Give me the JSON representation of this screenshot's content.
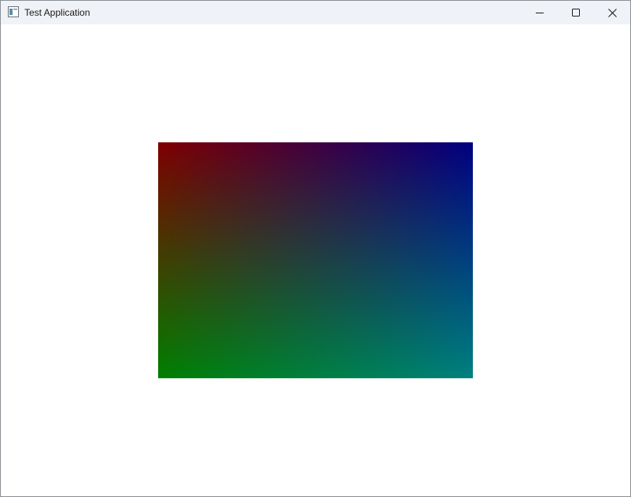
{
  "window": {
    "title": "Test Application",
    "app_icon": "window-app-icon",
    "caption_buttons": [
      {
        "name": "minimize",
        "icon": "minimize-icon"
      },
      {
        "name": "maximize",
        "icon": "maximize-icon"
      },
      {
        "name": "close",
        "icon": "close-icon"
      }
    ]
  },
  "canvas": {
    "corner_colors": {
      "top_left": "#800000",
      "top_right": "#000080",
      "bottom_left": "#008000",
      "bottom_right": "#008080"
    }
  }
}
